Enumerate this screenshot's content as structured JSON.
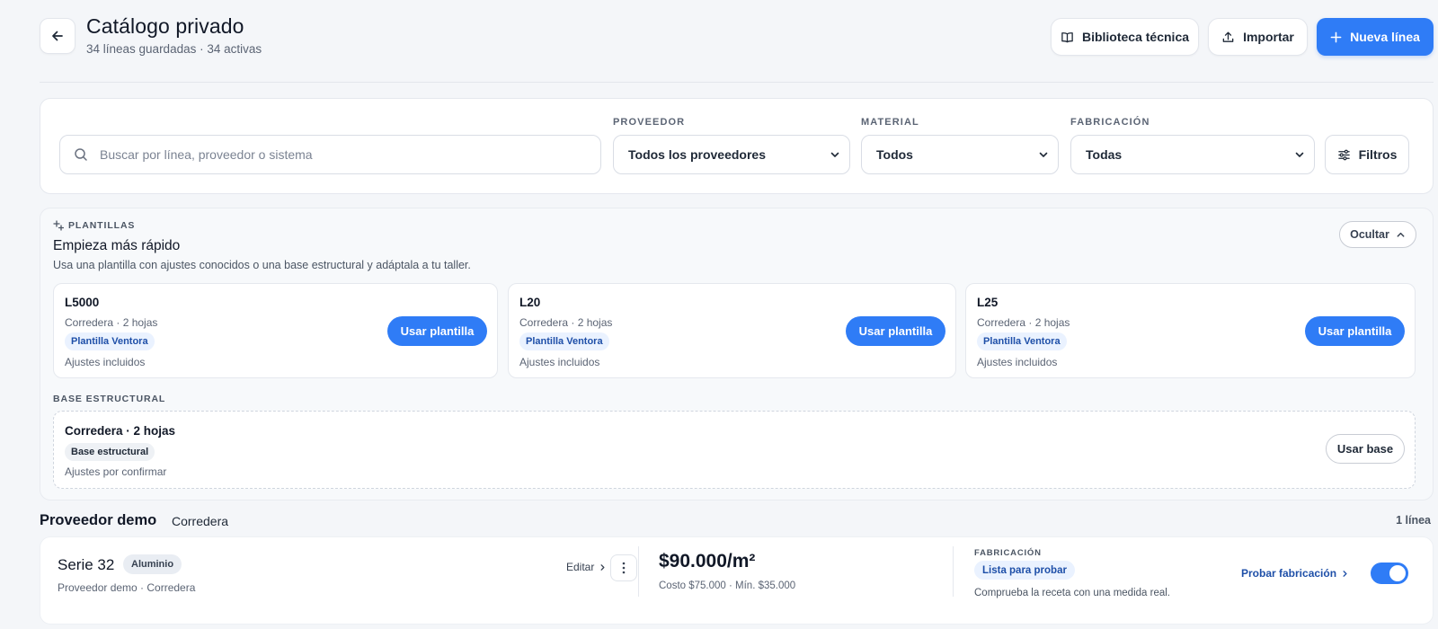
{
  "header": {
    "title": "Catálogo privado",
    "subtitle": "34 líneas guardadas · 34 activas",
    "actions": {
      "library": "Biblioteca técnica",
      "import": "Importar",
      "new_line": "Nueva línea"
    }
  },
  "filters": {
    "search_placeholder": "Buscar por línea, proveedor o sistema",
    "supplier": {
      "label": "PROVEEDOR",
      "value": "Todos los proveedores"
    },
    "material": {
      "label": "MATERIAL",
      "value": "Todos"
    },
    "fabrication": {
      "label": "FABRICACIÓN",
      "value": "Todas"
    },
    "more_filters": "Filtros"
  },
  "templates": {
    "section_label": "PLANTILLAS",
    "title": "Empieza más rápido",
    "description": "Usa una plantilla con ajustes conocidos o una base estructural y adáptala a tu taller.",
    "hide_label": "Ocultar",
    "items": [
      {
        "name": "L5000",
        "meta": "Corredera · 2 hojas",
        "badge": "Plantilla Ventora",
        "footer": "Ajustes incluidos",
        "action": "Usar plantilla"
      },
      {
        "name": "L20",
        "meta": "Corredera · 2 hojas",
        "badge": "Plantilla Ventora",
        "footer": "Ajustes incluidos",
        "action": "Usar plantilla"
      },
      {
        "name": "L25",
        "meta": "Corredera · 2 hojas",
        "badge": "Plantilla Ventora",
        "footer": "Ajustes incluidos",
        "action": "Usar plantilla"
      }
    ],
    "base": {
      "section_label": "BASE ESTRUCTURAL",
      "name": "Corredera · 2 hojas",
      "badge": "Base estructural",
      "footer": "Ajustes por confirmar",
      "action": "Usar base"
    }
  },
  "group": {
    "supplier": "Proveedor demo",
    "system": "Corredera",
    "count": "1 línea",
    "lines": [
      {
        "name": "Serie 32",
        "material": "Aluminio",
        "meta": "Proveedor demo · Corredera",
        "edit": "Editar",
        "price": "$90.000/m²",
        "price_sub": "Costo $75.000 · Mín. $35.000",
        "fab_label": "FABRICACIÓN",
        "status": "Lista para probar",
        "fab_desc": "Comprueba la receta con una medida real.",
        "try_action": "Probar fabricación",
        "active": true
      }
    ]
  },
  "colors": {
    "accent": "#2f7cf6",
    "badge_bg": "#eaf2ff",
    "badge_text": "#1e4fa8",
    "page_bg": "#f4f6f9"
  },
  "icons": {
    "back": "arrow-left-icon",
    "library": "book-open-icon",
    "import": "upload-icon",
    "new": "plus-icon",
    "search": "search-icon",
    "filters": "sliders-icon",
    "templates": "sparkles-icon",
    "hide": "chevron-up-icon",
    "menu": "more-vertical-icon"
  }
}
